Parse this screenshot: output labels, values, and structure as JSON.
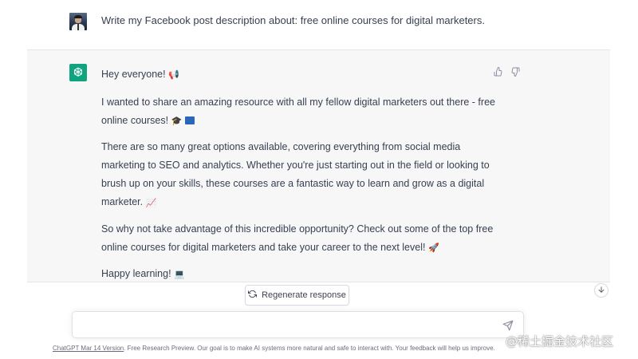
{
  "user_message": {
    "text": "Write my Facebook post description about: free online courses for digital marketers."
  },
  "assistant_message": {
    "greeting": "Hey everyone!",
    "greeting_emoji": "📢",
    "p1": "I wanted to share an amazing resource with all my fellow digital marketers out there - free online courses!",
    "p1_emoji": "🎓",
    "p2": "There are so many great options available, covering everything from social media marketing to SEO and analytics. Whether you're just starting out in the field or looking to brush up on your skills, these courses are a fantastic way to learn and grow as a digital marketer.",
    "p2_emoji": "📈",
    "p3": "So why not take advantage of this incredible opportunity? Check out some of the top free online courses for digital marketers and take your career to the next level!",
    "p3_emoji": "🚀",
    "p4": "Happy learning!",
    "p4_emoji": "💻"
  },
  "regenerate_label": "Regenerate response",
  "input": {
    "placeholder": ""
  },
  "footer": {
    "version_link": "ChatGPT Mar 14 Version",
    "text": ". Free Research Preview. Our goal is to make AI systems more natural and safe to interact with. Your feedback will help us improve."
  },
  "watermark": "@稀土掘金技术社区",
  "icons": {
    "avatar": "user-avatar",
    "logo": "openai-logo-icon",
    "thumbs_up": "thumbs-up-icon",
    "thumbs_down": "thumbs-down-icon",
    "regenerate": "refresh-icon",
    "scroll": "arrow-down-icon",
    "send": "send-icon"
  },
  "colors": {
    "accent": "#10a37f",
    "assistant_bg": "#f7f7f8",
    "text": "#374151"
  }
}
